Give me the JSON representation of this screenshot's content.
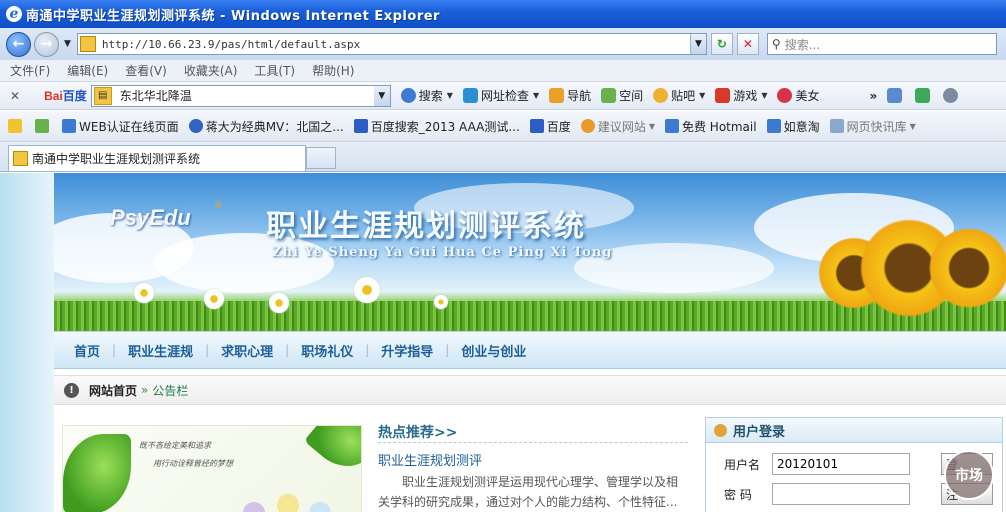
{
  "window": {
    "title": "南通中学职业生涯规划测评系统 - Windows Internet Explorer"
  },
  "address": {
    "url": "http://10.66.23.9/pas/html/default.aspx",
    "search_placeholder": "搜索..."
  },
  "menu": [
    "文件(F)",
    "编辑(E)",
    "查看(V)",
    "收藏夹(A)",
    "工具(T)",
    "帮助(H)"
  ],
  "baidu_toolbar": {
    "logo_bai": "Bai",
    "logo_du": "百度",
    "search_value": "东北华北降温",
    "items": [
      "搜索",
      "网址检查",
      "导航",
      "空间",
      "贴吧",
      "游戏",
      "美女"
    ]
  },
  "favorites": [
    "WEB认证在线页面",
    "蒋大为经典MV：北国之...",
    "百度搜索_2013 AAA测试...",
    "百度",
    "建议网站",
    "免费 Hotmail",
    "如意淘",
    "网页快讯库"
  ],
  "tab": {
    "label": "南通中学职业生涯规划测评系统"
  },
  "banner": {
    "logo": "PsyEdu",
    "logo_mark": "®",
    "title": "职业生涯规划测评系统",
    "pinyin": "Zhi Ye Sheng Ya Gui Hua Ce Ping Xi Tong"
  },
  "nav": [
    "首页",
    "职业生涯规",
    "求职心理",
    "职场礼仪",
    "升学指导",
    "创业与创业"
  ],
  "breadcrumb": {
    "home": "网站首页",
    "separator": "»",
    "current": "公告栏"
  },
  "promo": {
    "line1": "既不吝给定美和追求",
    "line2": "用行动诠释曾经的梦想"
  },
  "hot": {
    "title": "热点推荐>>",
    "link": "职业生涯规划测评",
    "desc": "职业生涯规划测评是运用现代心理学、管理学以及相关学科的研究成果，通过对个人的能力结构、个性特征..."
  },
  "login": {
    "title": "用户登录",
    "username_label": "用户名",
    "username_value": "20120101",
    "password_label": "密 码",
    "login_button": "登",
    "register_button": "注"
  },
  "watermark": "市场"
}
